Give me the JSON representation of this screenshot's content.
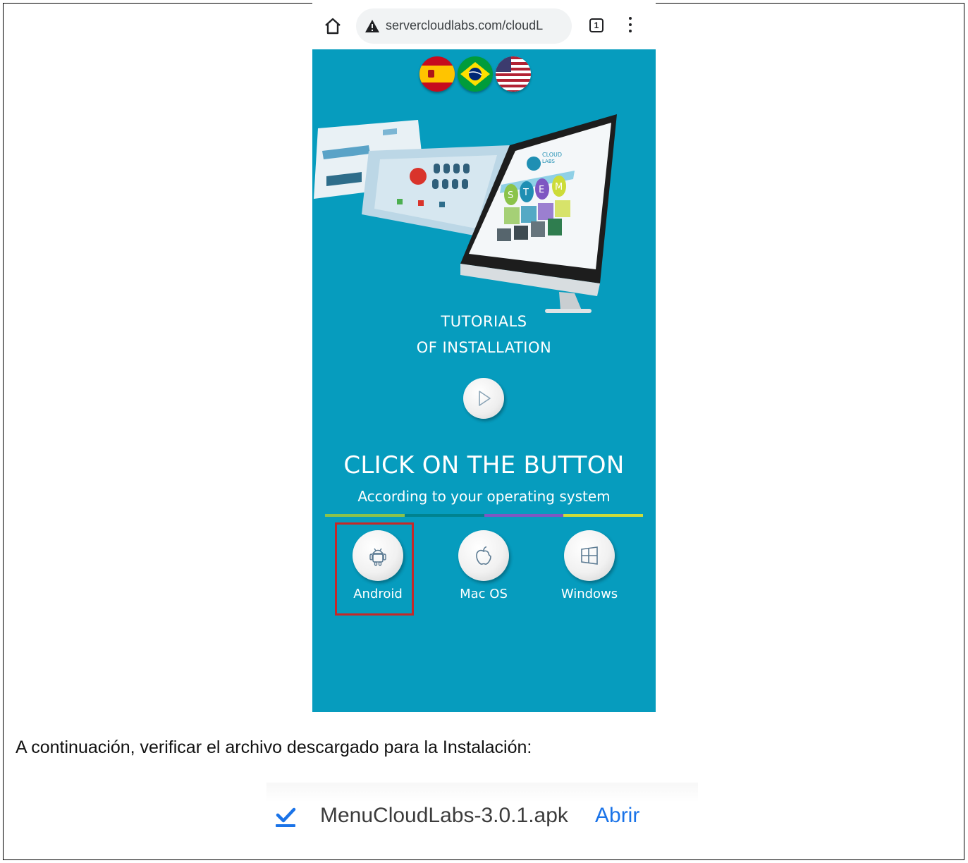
{
  "browser": {
    "url": "servercloudlabs.com/cloudL",
    "tab_count": "1"
  },
  "languages": [
    {
      "name": "Español",
      "icon": "spain-flag-icon"
    },
    {
      "name": "Português",
      "icon": "brazil-flag-icon"
    },
    {
      "name": "English",
      "icon": "usa-flag-icon"
    }
  ],
  "hero": {
    "screen_brand_top": "CLOUD",
    "screen_brand_bottom": "LABS",
    "stem_letters": [
      "S",
      "T",
      "E",
      "M"
    ]
  },
  "tutorials": {
    "line1": "TUTORIALS",
    "line2": "OF INSTALLATION"
  },
  "cta": {
    "title": "CLICK ON THE BUTTON",
    "subtitle": "According to your operating system"
  },
  "os_buttons": [
    {
      "label": "Android",
      "icon": "android-icon",
      "highlighted": true
    },
    {
      "label": "Mac OS",
      "icon": "apple-icon",
      "highlighted": false
    },
    {
      "label": "Windows",
      "icon": "windows-icon",
      "highlighted": false
    }
  ],
  "colors": {
    "page_bg": "#069cbe",
    "highlight": "#c62828",
    "bar": [
      "#8bc34a",
      "#00838f",
      "#7e57c2",
      "#cddc39"
    ],
    "link": "#1a73e8"
  },
  "instruction": "A continuación, verificar el archivo descargado para la Instalación:",
  "download": {
    "filename": "MenuCloudLabs-3.0.1.apk",
    "action": "Abrir"
  }
}
